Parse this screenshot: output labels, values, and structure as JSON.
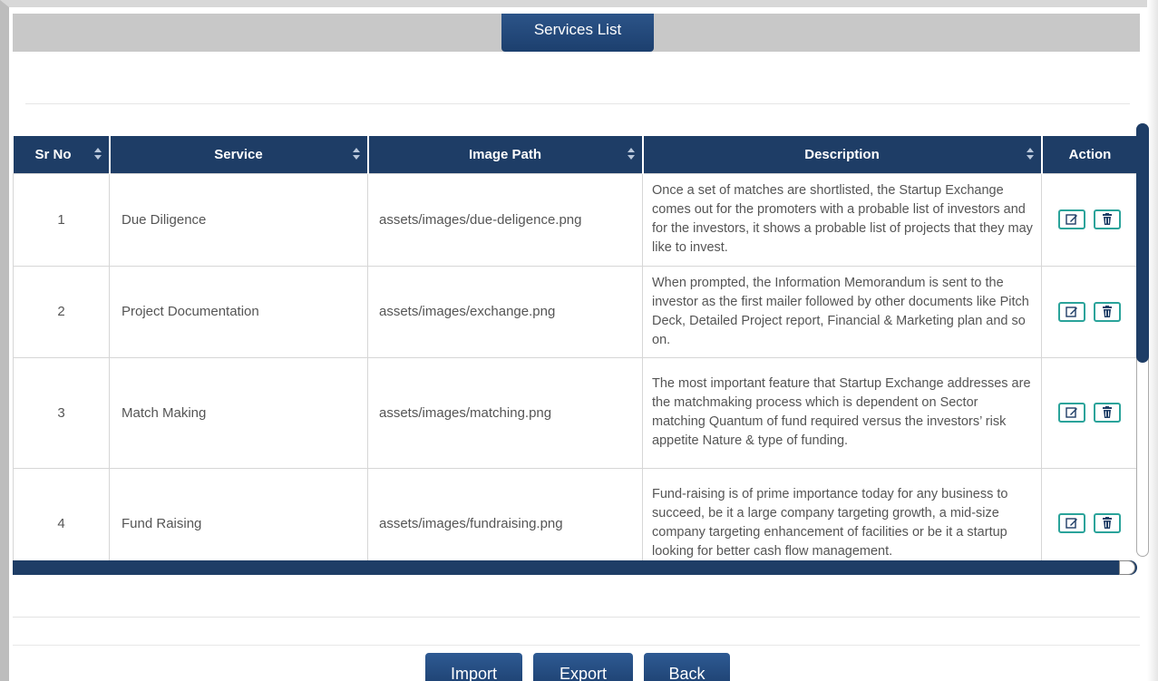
{
  "page": {
    "title": "Services List"
  },
  "table": {
    "headers": [
      "Sr No",
      "Service",
      "Image Path",
      "Description",
      "Action"
    ],
    "rows": [
      {
        "sr": "1",
        "service": "Due Diligence",
        "image_path": "assets/images/due-deligence.png",
        "description": "Once a set of matches are shortlisted, the Startup Exchange comes out for the promoters with a probable list of investors and for the investors, it shows a probable list of projects that they may like to invest."
      },
      {
        "sr": "2",
        "service": "Project Documentation",
        "image_path": "assets/images/exchange.png",
        "description": "When prompted, the Information Memorandum is sent to the investor as the first mailer followed by other documents like Pitch Deck, Detailed Project report, Financial & Marketing plan and so on."
      },
      {
        "sr": "3",
        "service": "Match Making",
        "image_path": "assets/images/matching.png",
        "description": "The most important feature that Startup Exchange addresses are the matchmaking process which is dependent on Sector matching Quantum of fund required versus the investors’ risk appetite Nature & type of funding."
      },
      {
        "sr": "4",
        "service": "Fund Raising",
        "image_path": "assets/images/fundraising.png",
        "description": "Fund-raising is of prime importance today for any business to succeed, be it a large company targeting growth, a mid-size company targeting enhancement of facilities or be it a startup looking for better cash flow management."
      }
    ],
    "actions": {
      "edit_icon": "edit-icon",
      "delete_icon": "trash-icon"
    }
  },
  "footer": {
    "import_label": "Import",
    "export_label": "Export",
    "back_label": "Back"
  },
  "colors": {
    "header_bg": "#1e3d66",
    "action_border": "#2aa39a",
    "band_gray": "#c8c8c8"
  }
}
